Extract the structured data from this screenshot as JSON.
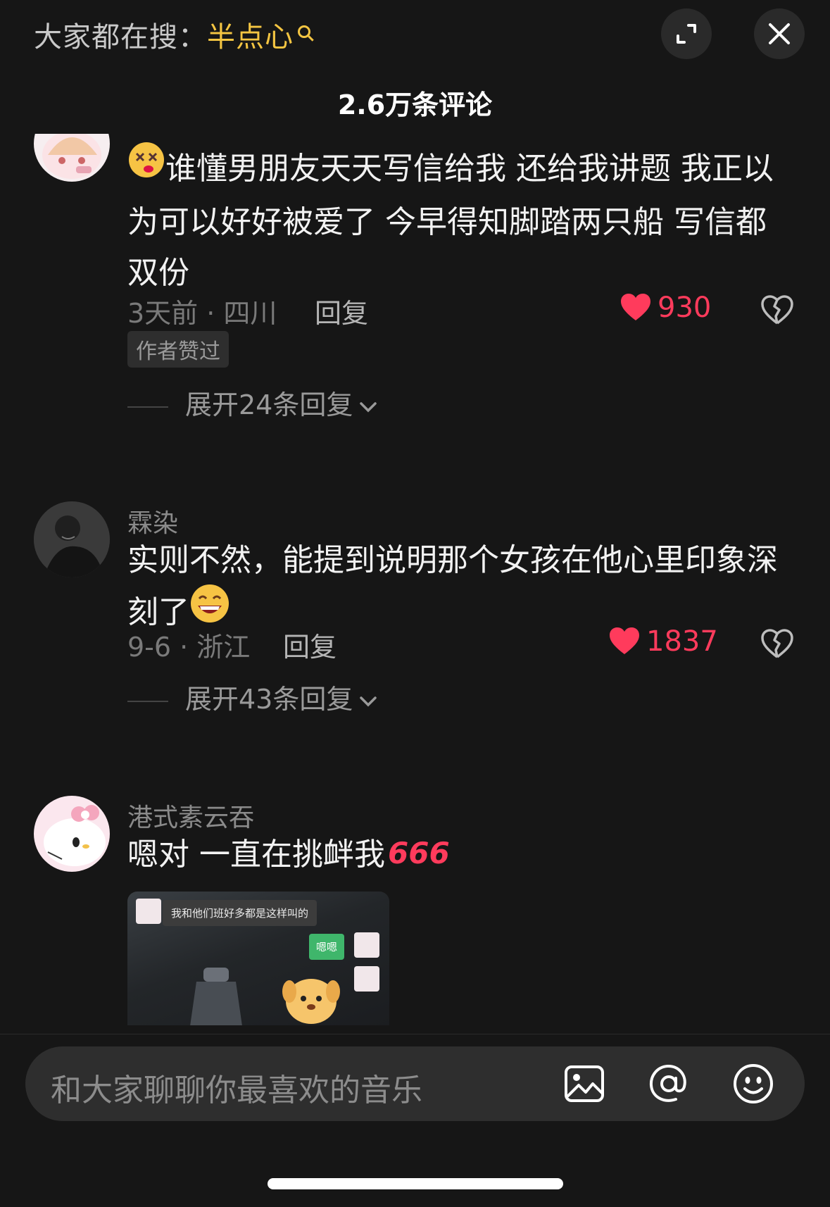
{
  "header": {
    "search_prefix": "大家都在搜：",
    "search_keyword": "半点心",
    "comment_count": "2.6万条评论"
  },
  "comments": [
    {
      "text": "谁懂男朋友天天写信给我 还给我讲题 我正以为可以好好被爱了 今早得知脚踏两只船 写信都双份",
      "time_location": "3天前 · 四川",
      "reply_label": "回复",
      "likes": "930",
      "badge": "作者赞过",
      "expand_label": "展开24条回复"
    },
    {
      "username": "霖染",
      "text": "实则不然，能提到说明那个女孩在他心里印象深刻了",
      "time_location": "9-6 · 浙江",
      "reply_label": "回复",
      "likes": "1837",
      "expand_label": "展开43条回复"
    },
    {
      "username": "港式素云吞",
      "text": "嗯对 一直在挑衅我",
      "sticker_text": "666",
      "image": {
        "bubble_left": "我和他们班好多都是这样叫的",
        "bubble_right": "嗯嗯"
      }
    }
  ],
  "input": {
    "placeholder": "和大家聊聊你最喜欢的音乐"
  },
  "colors": {
    "background": "#161616",
    "accent_like": "#ff3b5c",
    "search_keyword": "#f4c542"
  }
}
